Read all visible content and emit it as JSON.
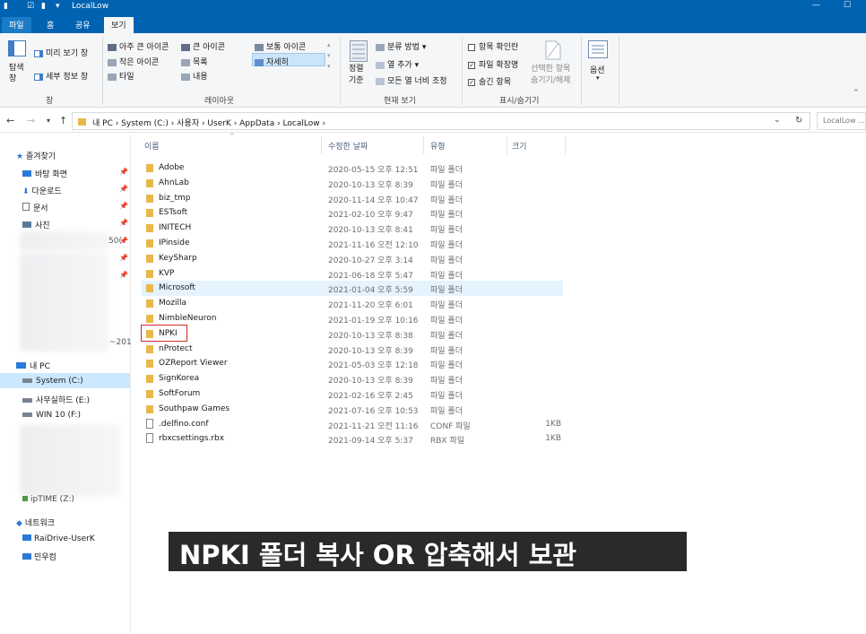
{
  "titlebar": {
    "title": "LocalLow",
    "qa_icons": [
      "folder-icon",
      "checkbox-icon",
      "folder-icon",
      "dropdown-icon"
    ],
    "minimize": "—",
    "maximize": "☐"
  },
  "ribbon_tabs": [
    "파일",
    "홈",
    "공유",
    "보기"
  ],
  "ribbon": {
    "pane": {
      "nav_pane": "탐색\n창",
      "preview_pane": "미리 보기 창",
      "details_pane": "세부 정보 창",
      "group_label": "창"
    },
    "layout": {
      "options": [
        "아주 큰 아이콘",
        "큰 아이콘",
        "보통 아이콘",
        "작은 아이콘",
        "목록",
        "자세히",
        "타일",
        "내용"
      ],
      "selected": "자세히",
      "group_label": "레이아웃"
    },
    "current_view": {
      "sort_by": "정렬\n기준",
      "group_by": "분류 방법",
      "add_columns": "열 추가",
      "size_all_columns": "모든 열 너비 조정",
      "group_label": "현재 보기"
    },
    "show_hide": {
      "item_checkboxes": {
        "label": "항목 확인란",
        "checked": false
      },
      "file_extensions": {
        "label": "파일 확장명",
        "checked": true
      },
      "hidden_items": {
        "label": "숨긴 항목",
        "checked": true
      },
      "hide_selected": "선택한 항목\n숨기기/해제",
      "group_label": "표시/숨기기"
    },
    "options": {
      "label": "옵션"
    }
  },
  "address": {
    "crumbs": "내 PC  ›  System (C:)  ›  사용자  ›  UserK  ›  AppData  ›  LocalLow  ›",
    "search_placeholder": "LocalLow ..."
  },
  "nav": {
    "quick_access": "즐겨찾기",
    "pinned": [
      "바탕 화면",
      "다운로드",
      "문서",
      "사진"
    ],
    "blurred_fragments": [
      "50(",
      "~201"
    ],
    "this_pc": "내 PC",
    "drives": [
      "System (C:)",
      "사무실하드 (E:)",
      "WIN 10 (F:)"
    ],
    "iptime": "ipTIME (Z:)",
    "network": "네트워크",
    "network_items": [
      "RaiDrive-UserK",
      "민우컴"
    ]
  },
  "columns": {
    "name": "이름",
    "date": "수정한 날짜",
    "type": "유형",
    "size": "크기"
  },
  "files": [
    {
      "name": "Adobe",
      "date": "2020-05-15 오후 12:51",
      "type": "파일 폴더",
      "size": "",
      "kind": "folder"
    },
    {
      "name": "AhnLab",
      "date": "2020-10-13 오후 8:39",
      "type": "파일 폴더",
      "size": "",
      "kind": "folder"
    },
    {
      "name": "biz_tmp",
      "date": "2020-11-14 오후 10:47",
      "type": "파일 폴더",
      "size": "",
      "kind": "folder"
    },
    {
      "name": "ESTsoft",
      "date": "2021-02-10 오후 9:47",
      "type": "파일 폴더",
      "size": "",
      "kind": "folder"
    },
    {
      "name": "INITECH",
      "date": "2020-10-13 오후 8:41",
      "type": "파일 폴더",
      "size": "",
      "kind": "folder"
    },
    {
      "name": "IPinside",
      "date": "2021-11-16 오전 12:10",
      "type": "파일 폴더",
      "size": "",
      "kind": "folder"
    },
    {
      "name": "KeySharp",
      "date": "2020-10-27 오후 3:14",
      "type": "파일 폴더",
      "size": "",
      "kind": "folder"
    },
    {
      "name": "KVP",
      "date": "2021-06-18 오후 5:47",
      "type": "파일 폴더",
      "size": "",
      "kind": "folder"
    },
    {
      "name": "Microsoft",
      "date": "2021-01-04 오후 5:59",
      "type": "파일 폴더",
      "size": "",
      "kind": "folder"
    },
    {
      "name": "Mozilla",
      "date": "2021-11-20 오후 6:01",
      "type": "파일 폴더",
      "size": "",
      "kind": "folder"
    },
    {
      "name": "NimbleNeuron",
      "date": "2021-01-19 오후 10:16",
      "type": "파일 폴더",
      "size": "",
      "kind": "folder"
    },
    {
      "name": "NPKI",
      "date": "2020-10-13 오후 8:38",
      "type": "파일 폴더",
      "size": "",
      "kind": "folder"
    },
    {
      "name": "nProtect",
      "date": "2020-10-13 오후 8:39",
      "type": "파일 폴더",
      "size": "",
      "kind": "folder"
    },
    {
      "name": "OZReport Viewer",
      "date": "2021-05-03 오후 12:18",
      "type": "파일 폴더",
      "size": "",
      "kind": "folder"
    },
    {
      "name": "SignKorea",
      "date": "2020-10-13 오후 8:39",
      "type": "파일 폴더",
      "size": "",
      "kind": "folder"
    },
    {
      "name": "SoftForum",
      "date": "2021-02-16 오후 2:45",
      "type": "파일 폴더",
      "size": "",
      "kind": "folder"
    },
    {
      "name": "Southpaw Games",
      "date": "2021-07-16 오후 10:53",
      "type": "파일 폴더",
      "size": "",
      "kind": "folder"
    },
    {
      "name": ".delfino.conf",
      "date": "2021-11-21 오전 11:16",
      "type": "CONF 파일",
      "size": "1KB",
      "kind": "file"
    },
    {
      "name": "rbxcsettings.rbx",
      "date": "2021-09-14 오후 5:37",
      "type": "RBX 파일",
      "size": "1KB",
      "kind": "file"
    }
  ],
  "highlighted_row": "Microsoft",
  "boxed_row": "NPKI",
  "caption": "NPKI 폴더 복사 OR 압축해서 보관",
  "colors": {
    "accent": "#0063b1",
    "folder": "#e8b84a",
    "highlight": "#d12b2b",
    "selection": "#cce8ff"
  }
}
